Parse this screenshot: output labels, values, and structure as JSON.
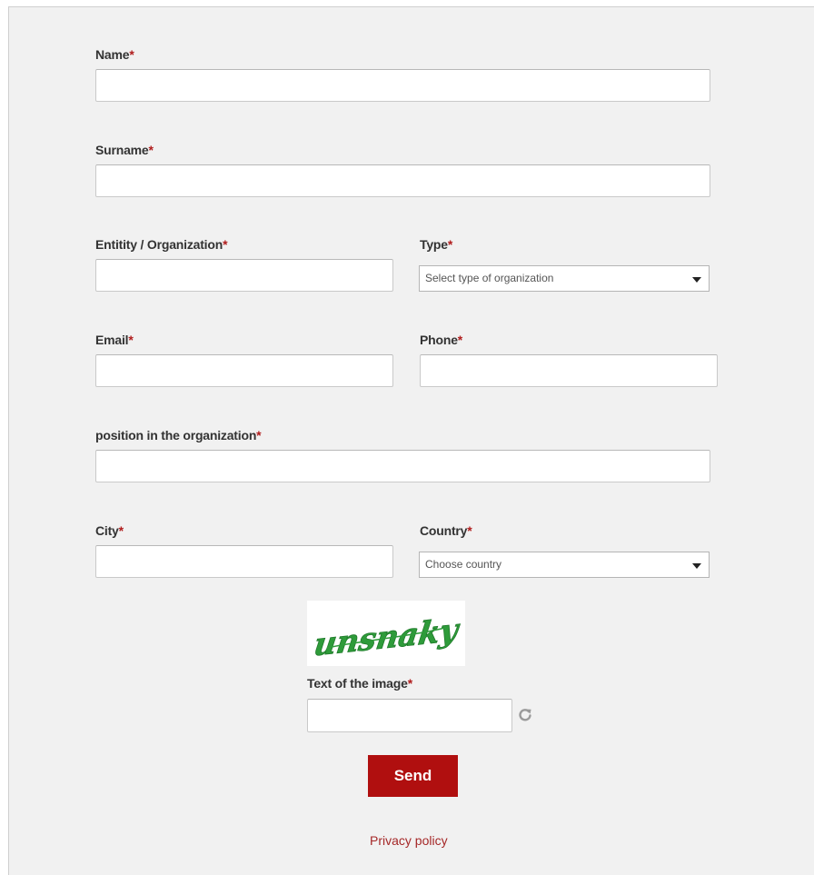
{
  "form": {
    "required_mark": "*",
    "name": {
      "label": "Name",
      "value": ""
    },
    "surname": {
      "label": "Surname",
      "value": ""
    },
    "organization": {
      "label": "Entitity / Organization",
      "value": ""
    },
    "type": {
      "label": "Type",
      "selected": "Select type of organization"
    },
    "email": {
      "label": "Email",
      "value": ""
    },
    "phone": {
      "label": "Phone",
      "value": ""
    },
    "position": {
      "label": "position in the organization",
      "value": ""
    },
    "city": {
      "label": "City",
      "value": ""
    },
    "country": {
      "label": "Country",
      "selected": "Choose country"
    },
    "captcha": {
      "label": "Text of the image",
      "value": "",
      "image_text": "unsnaky"
    },
    "send_label": "Send",
    "privacy_label": "Privacy policy"
  },
  "colors": {
    "accent": "#b00f0f",
    "required": "#b01c1c",
    "panel_bg": "#f1f1f1",
    "captcha_text": "#2e9b3a"
  },
  "icons": {
    "refresh": "refresh-icon",
    "dropdown": "chevron-down-icon"
  }
}
